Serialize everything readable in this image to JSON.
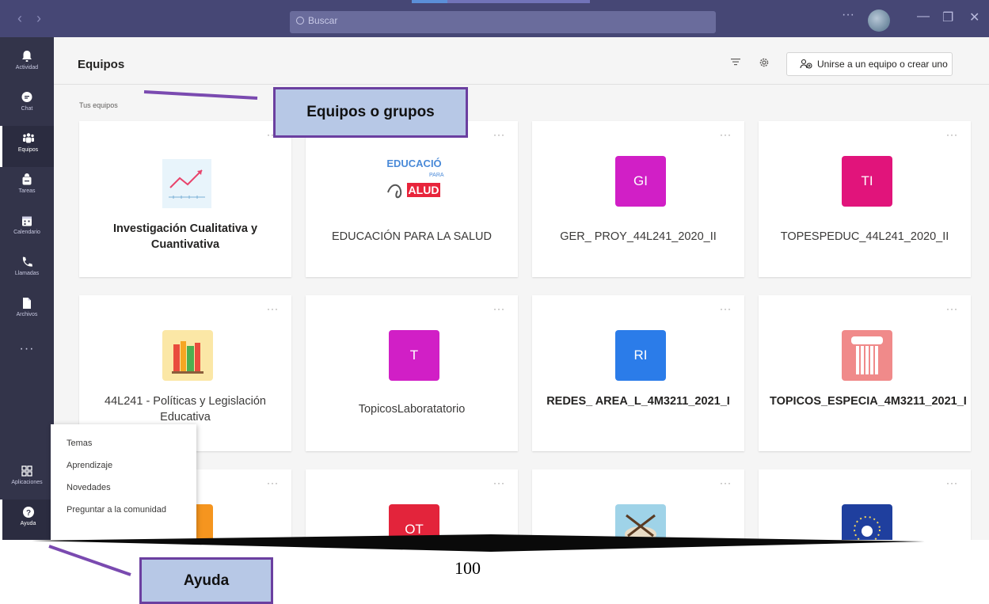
{
  "titlebar": {
    "search_placeholder": "Buscar",
    "more_label": "···",
    "minimize_label": "—",
    "restore_label": "❐",
    "close_label": "✕",
    "back_label": "‹",
    "forward_label": "›"
  },
  "rail": {
    "items": [
      {
        "label": "Actividad",
        "icon": "bell-icon"
      },
      {
        "label": "Chat",
        "icon": "chat-icon"
      },
      {
        "label": "Equipos",
        "icon": "teams-icon"
      },
      {
        "label": "Tareas",
        "icon": "backpack-icon"
      },
      {
        "label": "Calendario",
        "icon": "calendar-icon"
      },
      {
        "label": "Llamadas",
        "icon": "phone-icon"
      },
      {
        "label": "Archivos",
        "icon": "file-icon"
      }
    ],
    "more_label": "···",
    "apps_label": "Aplicaciones",
    "help_label": "Ayuda"
  },
  "header": {
    "title": "Equipos",
    "join_button": "Unirse a un equipo o crear uno"
  },
  "section_label": "Tus equipos",
  "teams": [
    {
      "name": "Investigación Cualitativa y Cuantivativa",
      "initials": "",
      "color": "#e8f4fb",
      "bold": true
    },
    {
      "name": "EDUCACIÓN PARA LA SALUD",
      "initials": "",
      "color": "#ffffff",
      "bold": false
    },
    {
      "name": "GER_ PROY_44L241_2020_II",
      "initials": "GI",
      "color": "#d11fc6",
      "bold": false
    },
    {
      "name": "TOPESPEDUC_44L241_2020_II",
      "initials": "TI",
      "color": "#e1147b",
      "bold": false
    },
    {
      "name": "44L241 - Políticas y Legislación Educativa",
      "initials": "",
      "color": "#fbe7a6",
      "bold": false
    },
    {
      "name": "TopicosLaboratatorio",
      "initials": "T",
      "color": "#d11fc6",
      "bold": false
    },
    {
      "name": "REDES_ AREA_L_4M3211_2021_I",
      "initials": "RI",
      "color": "#2b7ce9",
      "bold": true
    },
    {
      "name": "TOPICOS_ESPECIA_4M3211_2021_I",
      "initials": "",
      "color": "#f08a8a",
      "bold": true
    },
    {
      "name": "",
      "initials": "",
      "color": "#f5951f",
      "bold": false
    },
    {
      "name": "",
      "initials": "OT",
      "color": "#e3243b",
      "bold": false
    },
    {
      "name": "",
      "initials": "",
      "color": "#9fd3e8",
      "bold": false
    },
    {
      "name": "",
      "initials": "",
      "color": "#1f3f9e",
      "bold": false
    }
  ],
  "help_menu": [
    "Temas",
    "Aprendizaje",
    "Novedades",
    "Preguntar a la comunidad"
  ],
  "callouts": {
    "teams": "Equipos o grupos",
    "help": "Ayuda"
  },
  "page_number": "100",
  "colors": {
    "titlebar": "#464775",
    "rail": "#33344a",
    "callout_fill": "#b7c8e6",
    "callout_border": "#6b3fa0"
  }
}
